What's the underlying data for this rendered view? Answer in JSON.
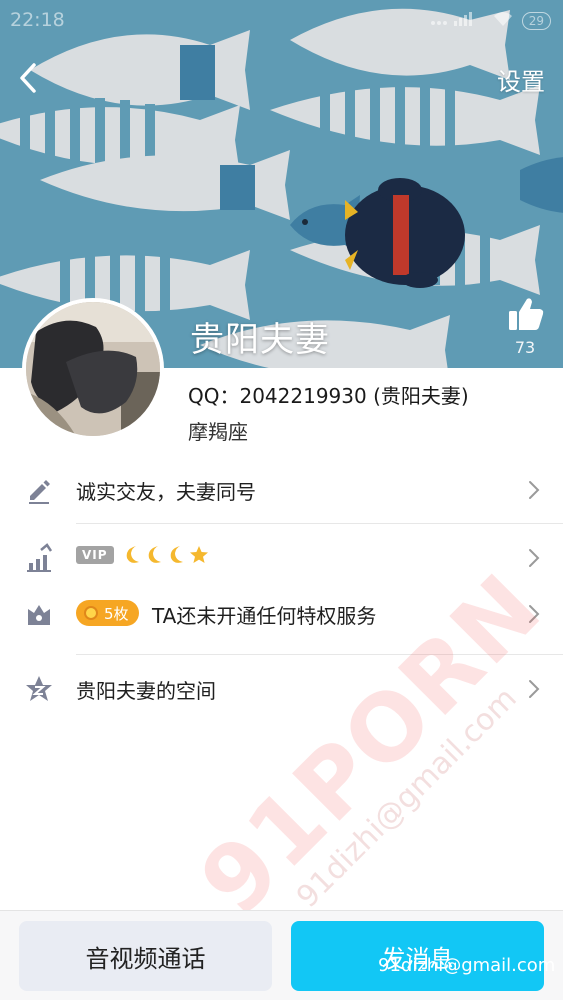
{
  "status_bar": {
    "time": "22:18",
    "battery": "29"
  },
  "header": {
    "settings_label": "设置"
  },
  "profile": {
    "nickname": "贵阳夫妻",
    "likes": "73",
    "qq_line": "QQ：2042219930 (贵阳夫妻)",
    "zodiac": "摩羯座"
  },
  "list": {
    "signature": "诚实交友，夫妻同号",
    "vip_tag": "VIP",
    "coin_count": "5枚",
    "privilege_text": "TA还未开通任何特权服务",
    "space_label": "贵阳夫妻的空间"
  },
  "bottom": {
    "call_label": "音视频通话",
    "message_label": "发消息"
  },
  "watermark": {
    "brand": "91PORN",
    "email": "91dizhi@gmail.com"
  },
  "colors": {
    "accent": "#12c7f5",
    "coin": "#f6a623",
    "banner": "#5f9bb4"
  }
}
